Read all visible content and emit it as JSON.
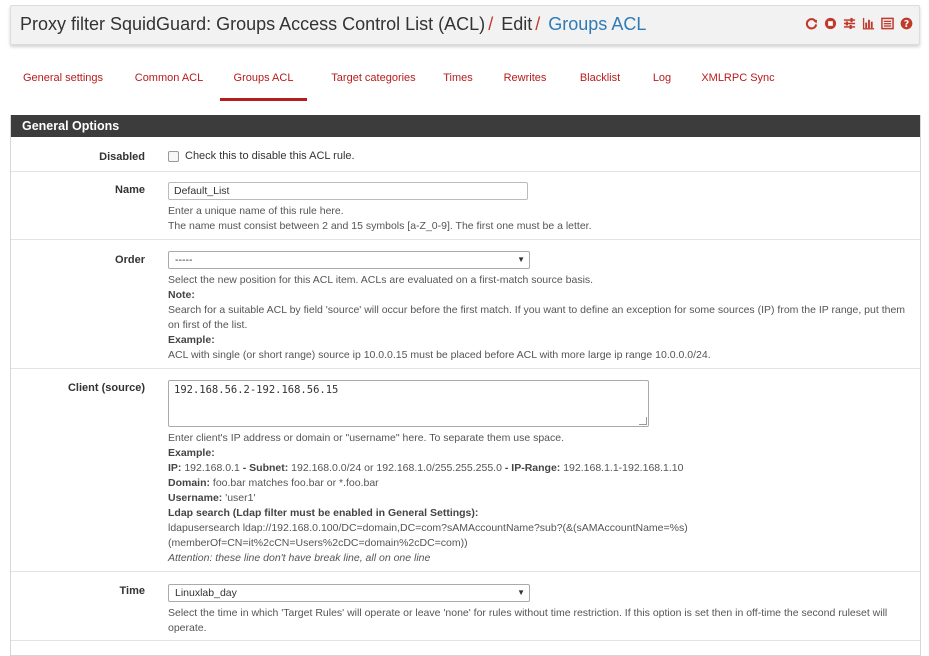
{
  "header": {
    "title_main": "Proxy filter SquidGuard: Groups Access Control List (ACL)",
    "sep1": "/",
    "crumb_edit": "Edit",
    "sep2": "/",
    "crumb_link": "Groups ACL",
    "icons": [
      "restart-icon",
      "stop-icon",
      "settings-sliders-icon",
      "chart-icon",
      "list-icon",
      "help-icon"
    ],
    "accent": "#c0392b"
  },
  "tabs": [
    {
      "label": "General settings"
    },
    {
      "label": "Common ACL"
    },
    {
      "label": "Groups ACL",
      "active": true
    },
    {
      "label": "Target categories"
    },
    {
      "label": "Times"
    },
    {
      "label": "Rewrites"
    },
    {
      "label": "Blacklist"
    },
    {
      "label": "Log"
    },
    {
      "label": "XMLRPC Sync"
    }
  ],
  "panel": {
    "title": "General Options",
    "disabled": {
      "label": "Disabled",
      "checkbox_text": "Check this to disable this ACL rule."
    },
    "name": {
      "label": "Name",
      "value": "Default_List",
      "help1": "Enter a unique name of this rule here.",
      "help2": "The name must consist between 2 and 15 symbols [a-Z_0-9]. The first one must be a letter."
    },
    "order": {
      "label": "Order",
      "selected": "-----",
      "help1": "Select the new position for this ACL item. ACLs are evaluated on a first-match source basis.",
      "note_label": "Note:",
      "note_text": "Search for a suitable ACL by field 'source' will occur before the first match. If you want to define an exception for some sources (IP) from the IP range, put them on first of the list.",
      "example_label": "Example:",
      "example_text": "ACL with single (or short range) source ip 10.0.0.15 must be placed before ACL with more large ip range 10.0.0.0/24."
    },
    "client": {
      "label": "Client (source)",
      "value": "192.168.56.2-192.168.56.15",
      "help1": "Enter client's IP address or domain or \"username\" here. To separate them use space.",
      "example_label": "Example:",
      "ip_label": "IP:",
      "ip_value": "192.168.0.1",
      "subnet_label": "- Subnet:",
      "subnet_value": "192.168.0.0/24 or 192.168.1.0/255.255.255.0",
      "range_label": "- IP-Range:",
      "range_value": "192.168.1.1-192.168.1.10",
      "domain_label": "Domain:",
      "domain_value": "foo.bar matches foo.bar or *.foo.bar",
      "username_label": "Username:",
      "username_value": "'user1'",
      "ldap_label": "Ldap search (Ldap filter must be enabled in General Settings):",
      "ldap_line1": "ldapusersearch ldap://192.168.0.100/DC=domain,DC=com?sAMAccountName?sub?(&(sAMAccountName=%s)",
      "ldap_line2": "(memberOf=CN=it%2cCN=Users%2cDC=domain%2cDC=com))",
      "attention": "Attention: these line don't have break line, all on one line"
    },
    "time": {
      "label": "Time",
      "selected": "Linuxlab_day",
      "help": "Select the time in which 'Target Rules' will operate or leave 'none' for rules without time restriction. If this option is set then in off-time the second ruleset will operate."
    }
  }
}
